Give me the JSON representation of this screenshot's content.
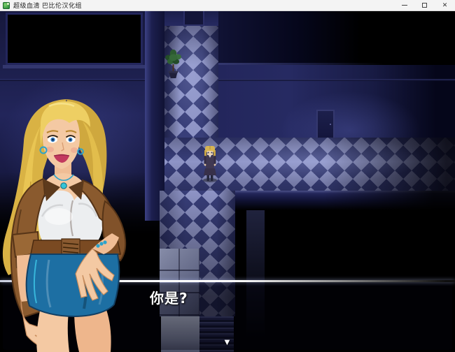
{
  "window": {
    "title": "超级血清 巴比伦汉化组",
    "app_icon": "rpg-maker-game-icon",
    "controls": {
      "minimize": "minimize-icon",
      "maximize": "maximize-icon",
      "close": "close-icon",
      "close_glyph": "✕"
    }
  },
  "dialog": {
    "text": "你是?",
    "continue_glyph": "▼"
  },
  "scene": {
    "plant": "potted-plant",
    "top_door": "corridor-end-door",
    "right_door": "north-wall-door",
    "stairs": "staircase-down",
    "player_sprite": "blonde-pixel-character",
    "portrait": "blonde-woman-bust-portrait"
  },
  "colors": {
    "checker_light": "#8e94c6",
    "checker_dark": "#383e79",
    "wall_navy": "#23265c",
    "dialog_line": "#ffffff",
    "hair": "#e9cb5e",
    "jacket": "#8a5a2e",
    "skirt": "#1d6fa3",
    "skin": "#f4c9a3",
    "titlebar_bg": "#f4f4f4"
  }
}
